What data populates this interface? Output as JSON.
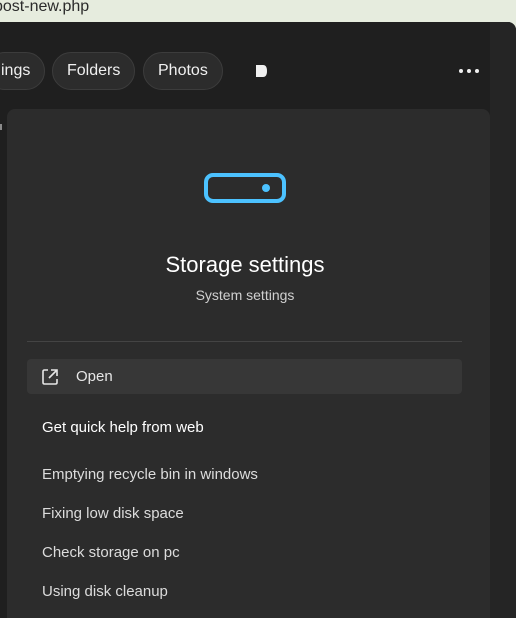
{
  "url_fragment": "post-new.php",
  "filters": [
    "ings",
    "Folders",
    "Photos"
  ],
  "result": {
    "title": "Storage settings",
    "subtitle": "System settings",
    "open_label": "Open"
  },
  "help": {
    "heading": "Get quick help from web",
    "links": [
      "Emptying recycle bin in windows",
      "Fixing low disk space",
      "Check storage on pc",
      "Using disk cleanup"
    ]
  },
  "colors": {
    "accent": "#4cc2ff",
    "panel": "#1f1f1f",
    "card": "#2c2c2c"
  },
  "icons": [
    "play-icon",
    "more-options-icon",
    "storage-drive-icon",
    "open-external-icon"
  ]
}
